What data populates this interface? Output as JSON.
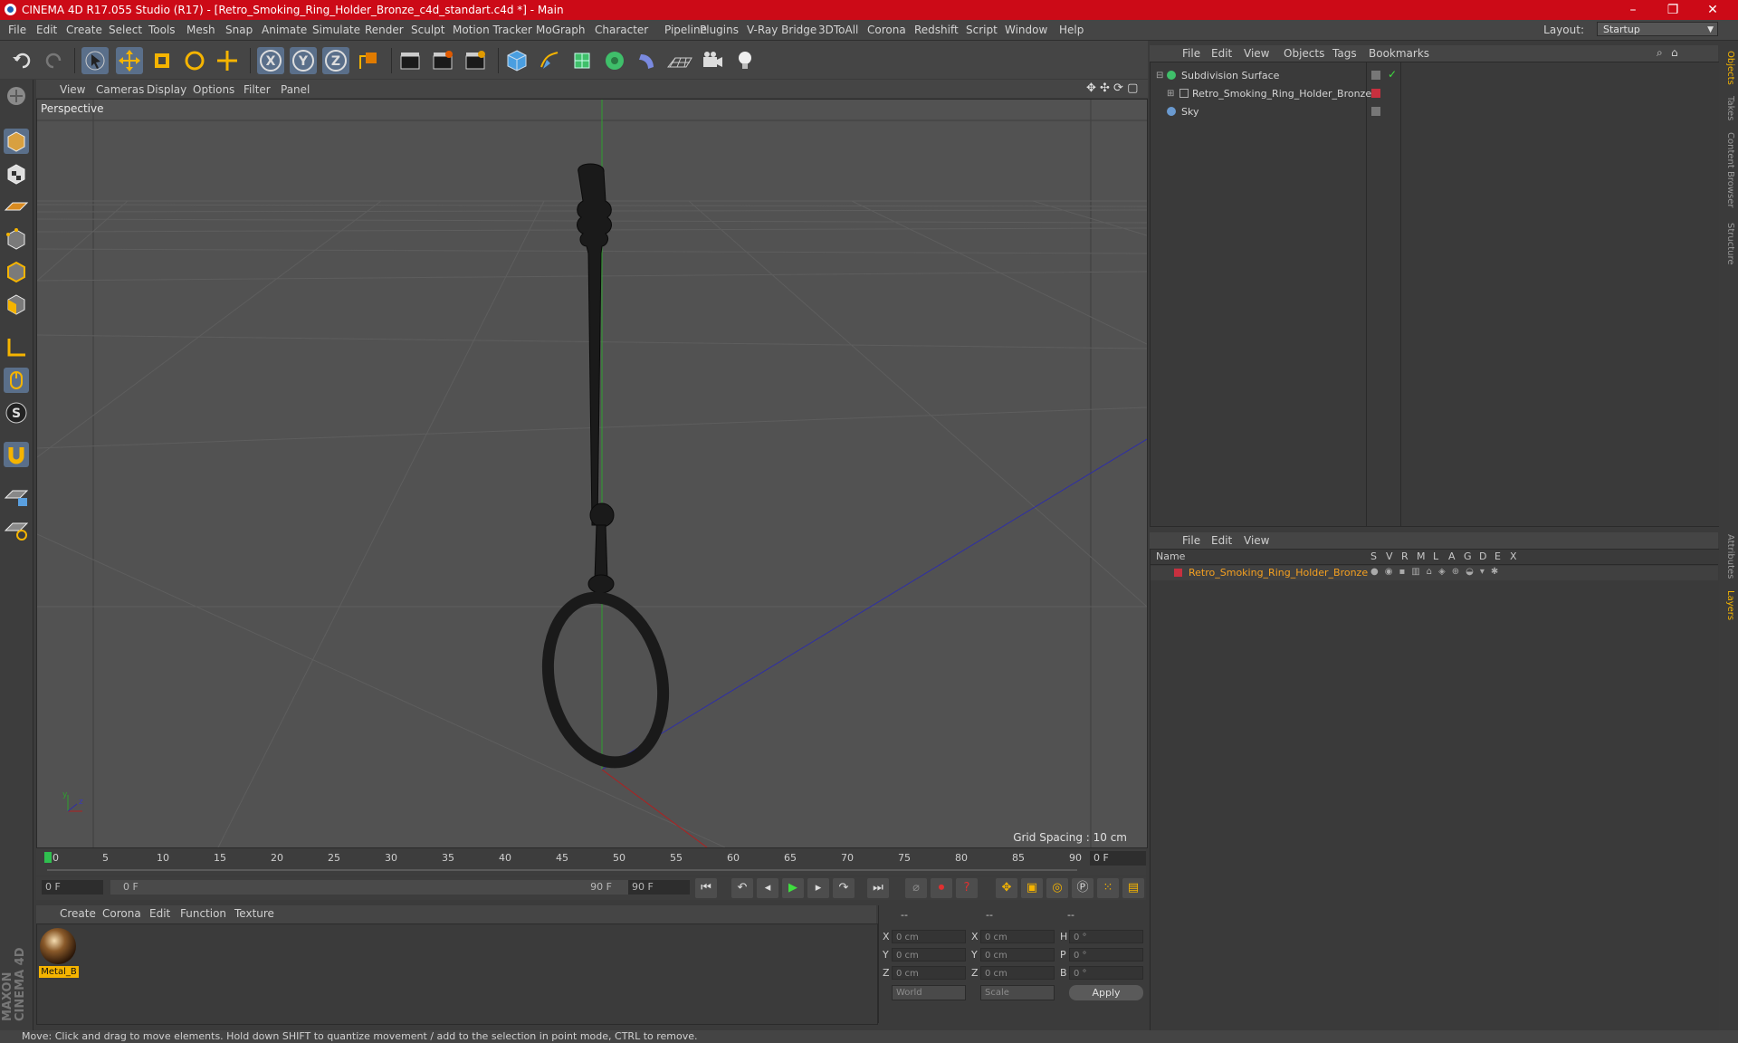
{
  "window": {
    "title": "CINEMA 4D R17.055 Studio (R17) - [Retro_Smoking_Ring_Holder_Bronze_c4d_standart.c4d *] - Main",
    "minimize": "–",
    "maximize": "❐",
    "close": "✕"
  },
  "menu": [
    "File",
    "Edit",
    "Create",
    "Select",
    "Tools",
    "Mesh",
    "Snap",
    "Animate",
    "Simulate",
    "Render",
    "Sculpt",
    "Motion Tracker",
    "MoGraph",
    "Character",
    "Pipeline",
    "Plugins",
    "V-Ray Bridge",
    "3DToAll",
    "Corona",
    "Redshift",
    "Script",
    "Window",
    "Help"
  ],
  "layout": {
    "label": "Layout:",
    "value": "Startup"
  },
  "viewport": {
    "menu": [
      "View",
      "Cameras",
      "Display",
      "Options",
      "Filter",
      "Panel"
    ],
    "label": "Perspective",
    "grid_spacing": "Grid Spacing : 10 cm"
  },
  "timeline": {
    "ticks": [
      "0",
      "5",
      "10",
      "15",
      "20",
      "25",
      "30",
      "35",
      "40",
      "45",
      "50",
      "55",
      "60",
      "65",
      "70",
      "75",
      "80",
      "85",
      "90"
    ],
    "current_frame": "0 F",
    "start_field": "0 F",
    "range_start": "0 F",
    "range_end": "90 F",
    "end_field": "90 F"
  },
  "material_manager": {
    "menu": [
      "Create",
      "Corona",
      "Edit",
      "Function",
      "Texture"
    ],
    "materials": [
      {
        "name": "Metal_B"
      }
    ]
  },
  "coordinates": {
    "header": [
      "--",
      "--",
      "--"
    ],
    "rows": [
      {
        "a": "X",
        "av": "0 cm",
        "b": "X",
        "bv": "0 cm",
        "c": "H",
        "cv": "0 °"
      },
      {
        "a": "Y",
        "av": "0 cm",
        "b": "Y",
        "bv": "0 cm",
        "c": "P",
        "cv": "0 °"
      },
      {
        "a": "Z",
        "av": "0 cm",
        "b": "Z",
        "bv": "0 cm",
        "c": "B",
        "cv": "0 °"
      }
    ],
    "mode": "World",
    "scale": "Scale",
    "apply": "Apply"
  },
  "object_manager": {
    "menu": [
      "File",
      "Edit",
      "View",
      "Objects",
      "Tags",
      "Bookmarks"
    ],
    "objects": [
      {
        "name": "Subdivision Surface"
      },
      {
        "name": "Retro_Smoking_Ring_Holder_Bronze"
      },
      {
        "name": "Sky"
      }
    ]
  },
  "layer_manager": {
    "menu": [
      "File",
      "Edit",
      "View"
    ],
    "columns": [
      "Name",
      "S",
      "V",
      "R",
      "M",
      "L",
      "A",
      "G",
      "D",
      "E",
      "X"
    ],
    "layers": [
      {
        "name": "Retro_Smoking_Ring_Holder_Bronze",
        "color": "#c8303f"
      }
    ]
  },
  "right_tabs": [
    "Objects",
    "Takes",
    "Content Browser",
    "Structure",
    "Attributes",
    "Layers"
  ],
  "status": "Move: Click and drag to move elements. Hold down SHIFT to quantize movement / add to the selection in point mode, CTRL to remove.",
  "brand": "MAXON CINEMA 4D"
}
